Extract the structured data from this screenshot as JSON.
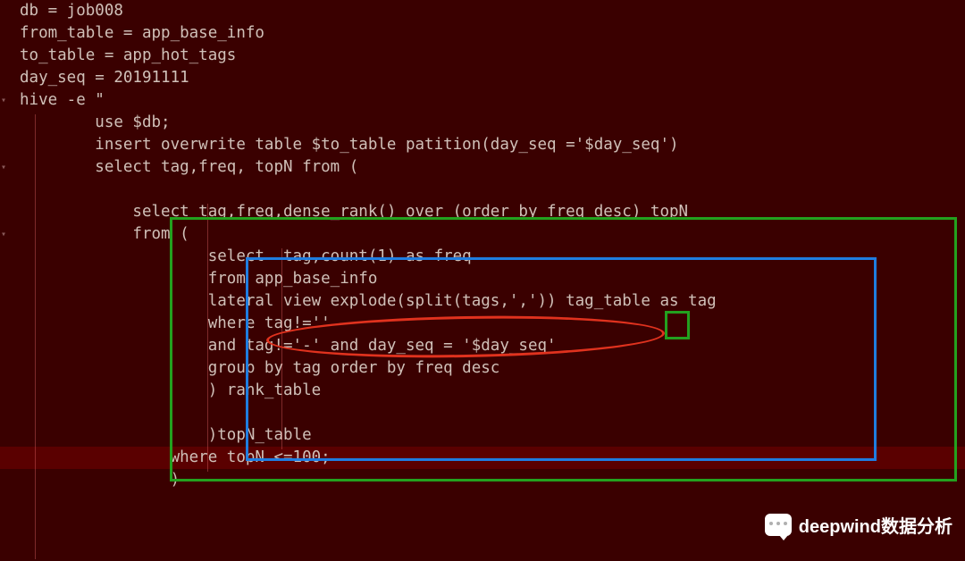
{
  "code": {
    "l1": "db = job008",
    "l2": "from_table = app_base_info",
    "l3": "to_table = app_hot_tags",
    "l4": "day_seq = 20191111",
    "l5": "hive -e \"",
    "l6": "        use $db;",
    "l7": "        insert overwrite table $to_table patition(day_seq ='$day_seq')",
    "l8": "        select tag,freq, topN from (",
    "l9": "",
    "l10": "            select tag,freq,dense_rank() over (order by freq desc) topN",
    "l11": "            from (",
    "l12": "                    select  tag,count(1) as freq",
    "l13": "                    from app_base_info",
    "l14": "                    lateral view explode(split(tags,',')) tag_table as tag",
    "l15": "                    where tag!=''",
    "l16": "                    and tag!='-' and day_seq = '$day_seq'",
    "l17": "                    group by tag order by freq desc",
    "l18": "                    ) rank_table",
    "l19": "",
    "l20": "                    )topN_table",
    "l21": "                where topN <=100;",
    "l22": "                )"
  },
  "vars": {
    "db": "job008",
    "from_table": "app_base_info",
    "to_table": "app_hot_tags",
    "day_seq": "20191111"
  },
  "annotations": {
    "green_box": "outer-subquery-highlight",
    "blue_box": "inner-subquery-highlight",
    "red_ellipse": "lateral-view-explode-highlight",
    "green_small_box": "small-marker"
  },
  "watermark": "deepwind数据分析"
}
